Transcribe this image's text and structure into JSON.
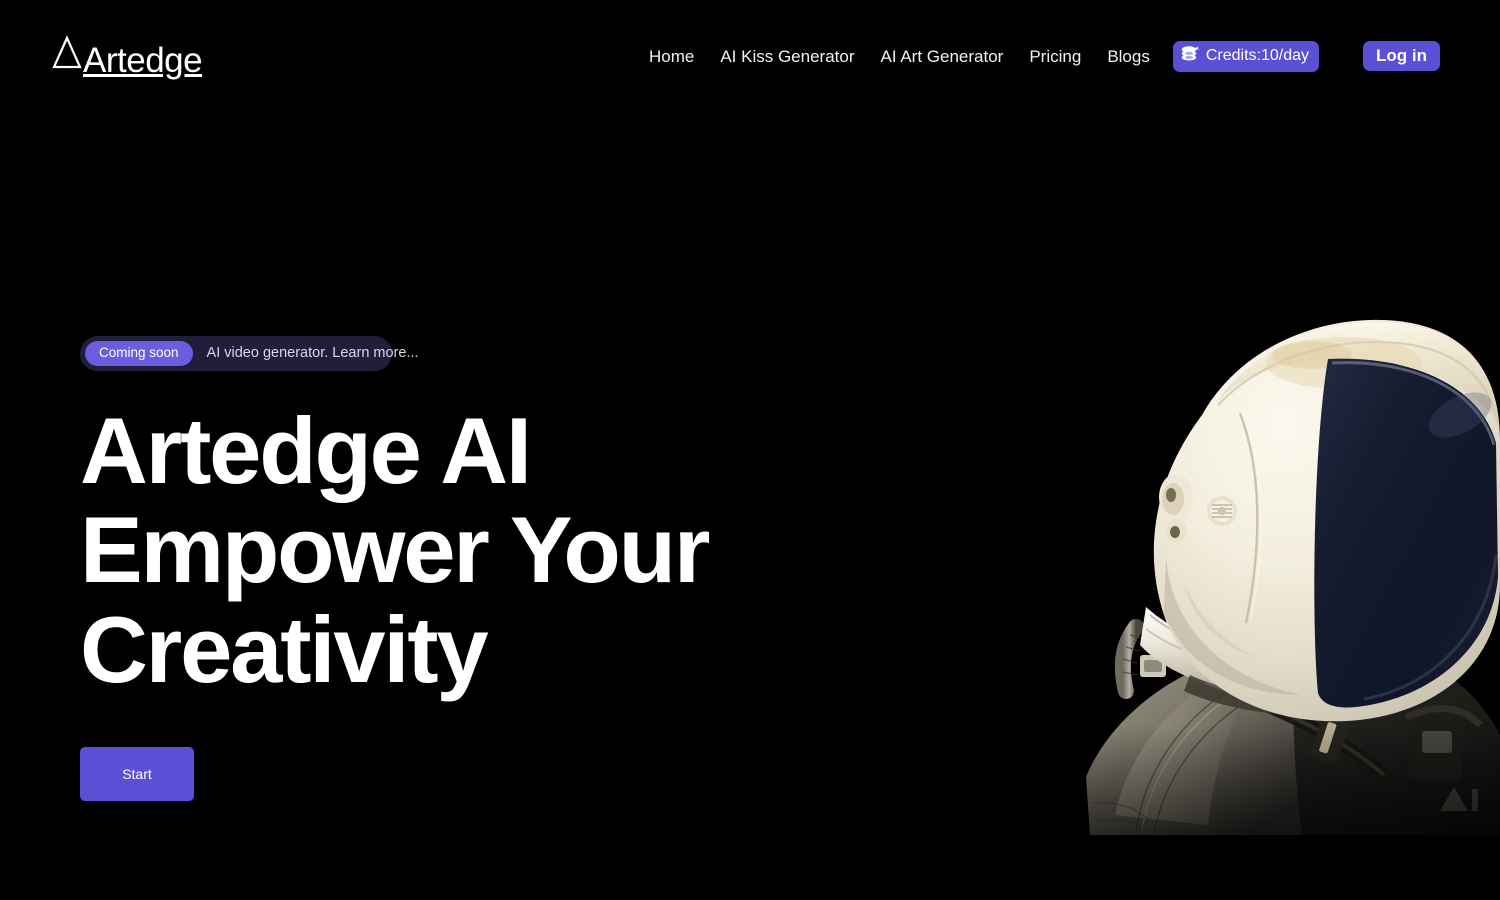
{
  "brand": {
    "name": "Artedge",
    "mark_icon": "triangle-a-icon"
  },
  "nav": {
    "items": [
      {
        "label": "Home",
        "name": "nav-link-home"
      },
      {
        "label": "AI Kiss Generator",
        "name": "nav-link-ai-kiss-generator"
      },
      {
        "label": "AI Art Generator",
        "name": "nav-link-ai-art-generator"
      },
      {
        "label": "Pricing",
        "name": "nav-link-pricing"
      },
      {
        "label": "Blogs",
        "name": "nav-link-blogs"
      }
    ],
    "credits": {
      "label": "Credits:10/day",
      "icon": "coin-stack-icon"
    },
    "login_label": "Log in"
  },
  "hero": {
    "announcement": {
      "pill_label": "Coming soon",
      "text": "AI video generator. Learn more..."
    },
    "headline": "Artedge AI Empower Your Creativity",
    "cta_label": "Start",
    "image_alt": "astronaut-portrait"
  },
  "colors": {
    "background": "#000000",
    "accent_purple": "#5B4FD6",
    "pill_purple": "#6C5CE0",
    "announce_bg": "#211E3C",
    "text_primary": "#FFFFFF",
    "text_muted": "#D9D7E8",
    "visor_navy": "#141B2E",
    "helmet_cream": "#F2EEE2",
    "suit_olive": "#7E7A6A"
  }
}
